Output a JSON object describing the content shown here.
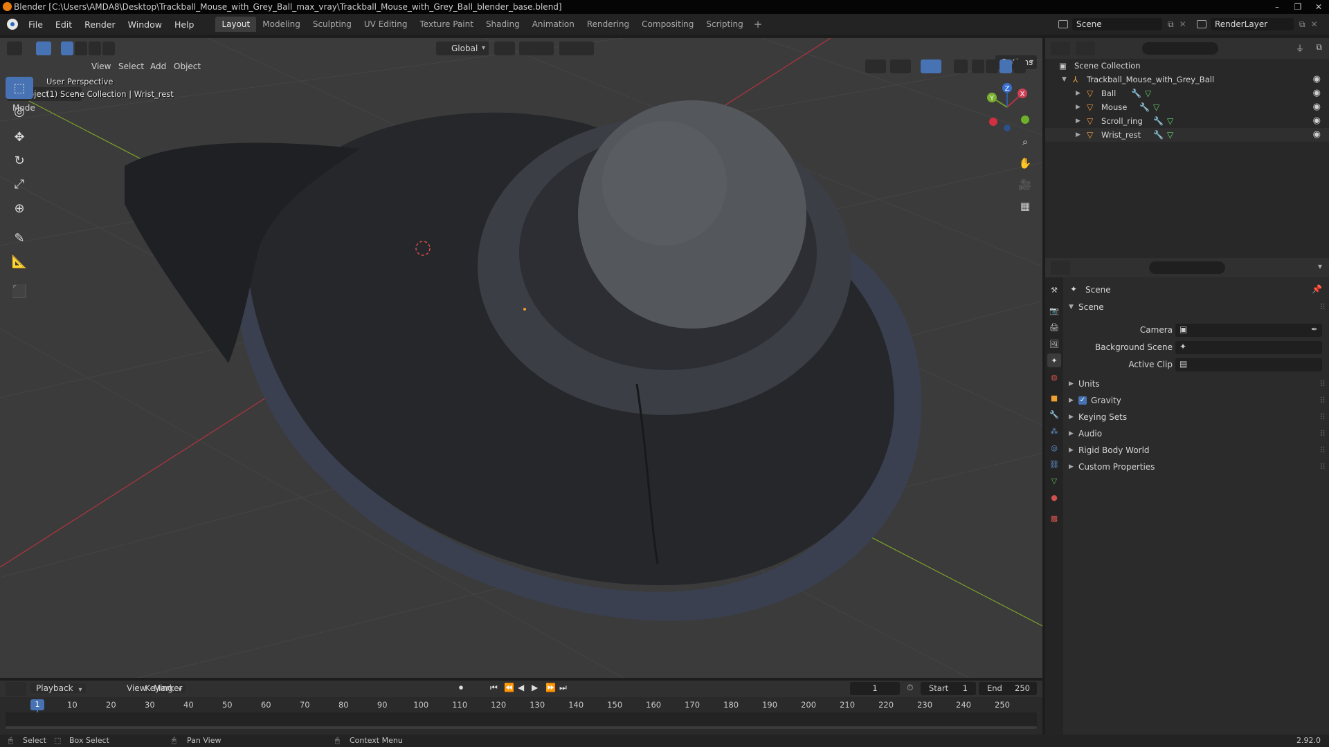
{
  "window": {
    "title": "Blender [C:\\Users\\AMDA8\\Desktop\\Trackball_Mouse_with_Grey_Ball_max_vray\\Trackball_Mouse_with_Grey_Ball_blender_base.blend]",
    "controls": [
      "–",
      "❐",
      "✕"
    ]
  },
  "menu": {
    "items": [
      "File",
      "Edit",
      "Render",
      "Window",
      "Help"
    ],
    "workspaces": [
      "Layout",
      "Modeling",
      "Sculpting",
      "UV Editing",
      "Texture Paint",
      "Shading",
      "Animation",
      "Rendering",
      "Compositing",
      "Scripting"
    ],
    "active_workspace": "Layout",
    "add_workspace": "+",
    "scene": "Scene",
    "view_layer": "RenderLayer"
  },
  "viewport": {
    "mode": "Object Mode",
    "header_menus": [
      "View",
      "Select",
      "Add",
      "Object"
    ],
    "orientation": "Global",
    "options_label": "Options",
    "overlay_line1": "User Perspective",
    "overlay_line2": "(1) Scene Collection | Wrist_rest",
    "gizmo_labels": {
      "x": "X",
      "y": "Y",
      "z": "Z"
    },
    "colors": {
      "background": "#3b3b3b",
      "grid": "#454545",
      "x_axis": "#b5343f",
      "y_axis": "#7ea52a",
      "mesh_dark": "#2a2b2f",
      "mesh_rim": "#3b4150",
      "ball": "#5a5d62"
    }
  },
  "outliner": {
    "root": "Scene Collection",
    "collection": "Trackball_Mouse_with_Grey_Ball",
    "objects": [
      {
        "name": "Ball"
      },
      {
        "name": "Mouse"
      },
      {
        "name": "Scroll_ring"
      },
      {
        "name": "Wrist_rest"
      }
    ]
  },
  "properties": {
    "context": "Scene",
    "panel_title": "Scene",
    "fields": [
      {
        "label": "Camera"
      },
      {
        "label": "Background Scene"
      },
      {
        "label": "Active Clip"
      }
    ],
    "panels": [
      {
        "label": "Units",
        "checkbox": false
      },
      {
        "label": "Gravity",
        "checkbox": true
      },
      {
        "label": "Keying Sets",
        "checkbox": false
      },
      {
        "label": "Audio",
        "checkbox": false
      },
      {
        "label": "Rigid Body World",
        "checkbox": false
      },
      {
        "label": "Custom Properties",
        "checkbox": false
      }
    ]
  },
  "timeline": {
    "menus": [
      "Playback",
      "Keying",
      "View",
      "Marker"
    ],
    "current_frame": "1",
    "start_label": "Start",
    "start": "1",
    "end_label": "End",
    "end": "250",
    "ticks": [
      "1",
      "10",
      "20",
      "30",
      "40",
      "50",
      "60",
      "70",
      "80",
      "90",
      "100",
      "110",
      "120",
      "130",
      "140",
      "150",
      "160",
      "170",
      "180",
      "190",
      "200",
      "210",
      "220",
      "230",
      "240",
      "250"
    ]
  },
  "statusbar": {
    "select": "Select",
    "box_select": "Box Select",
    "pan_view": "Pan View",
    "context_menu": "Context Menu",
    "version": "2.92.0"
  }
}
